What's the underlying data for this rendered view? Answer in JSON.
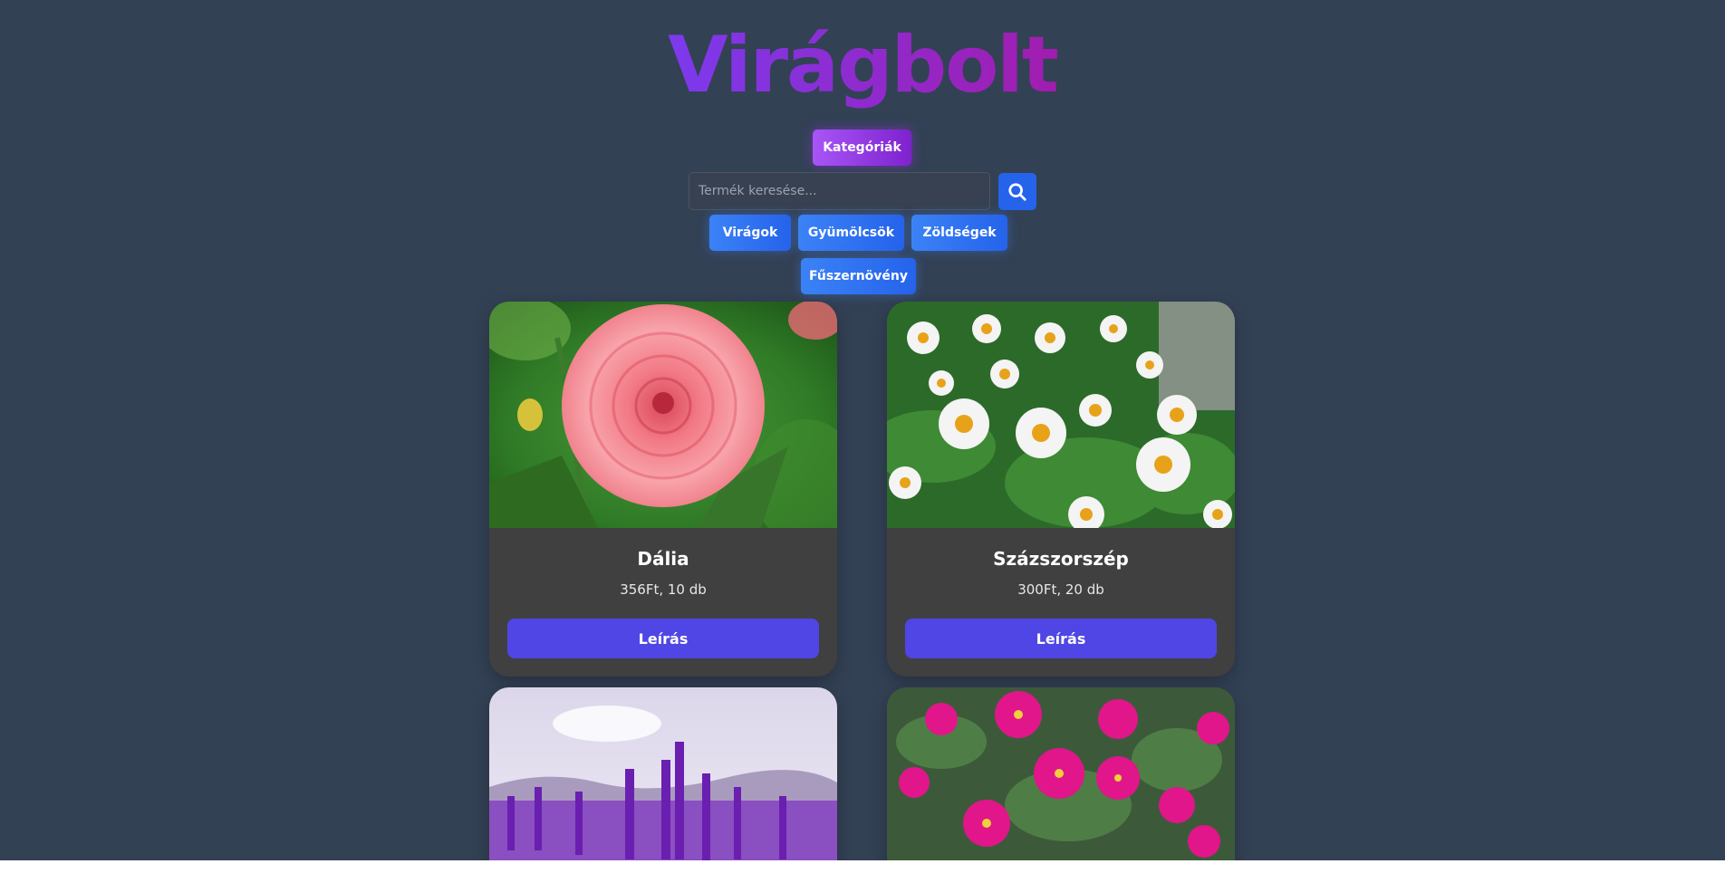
{
  "header": {
    "title": "Virágbolt"
  },
  "categories_button": {
    "label": "Kategóriák"
  },
  "search": {
    "placeholder": "Termék keresése..."
  },
  "filters": [
    {
      "label": "Virágok"
    },
    {
      "label": "Gyümölcsök"
    },
    {
      "label": "Zöldségek"
    },
    {
      "label": "Fűszernövény"
    }
  ],
  "products": [
    {
      "name": "Dália",
      "price": "356Ft, 10 db",
      "button": "Leírás"
    },
    {
      "name": "Százszorszép",
      "price": "300Ft, 20 db",
      "button": "Leírás"
    }
  ],
  "colors": {
    "background": "#334155",
    "title": "#9333ea",
    "category_button": "#9333ea",
    "filter_button": "#2563eb",
    "card": "#404040",
    "card_button": "#4f46e5"
  }
}
